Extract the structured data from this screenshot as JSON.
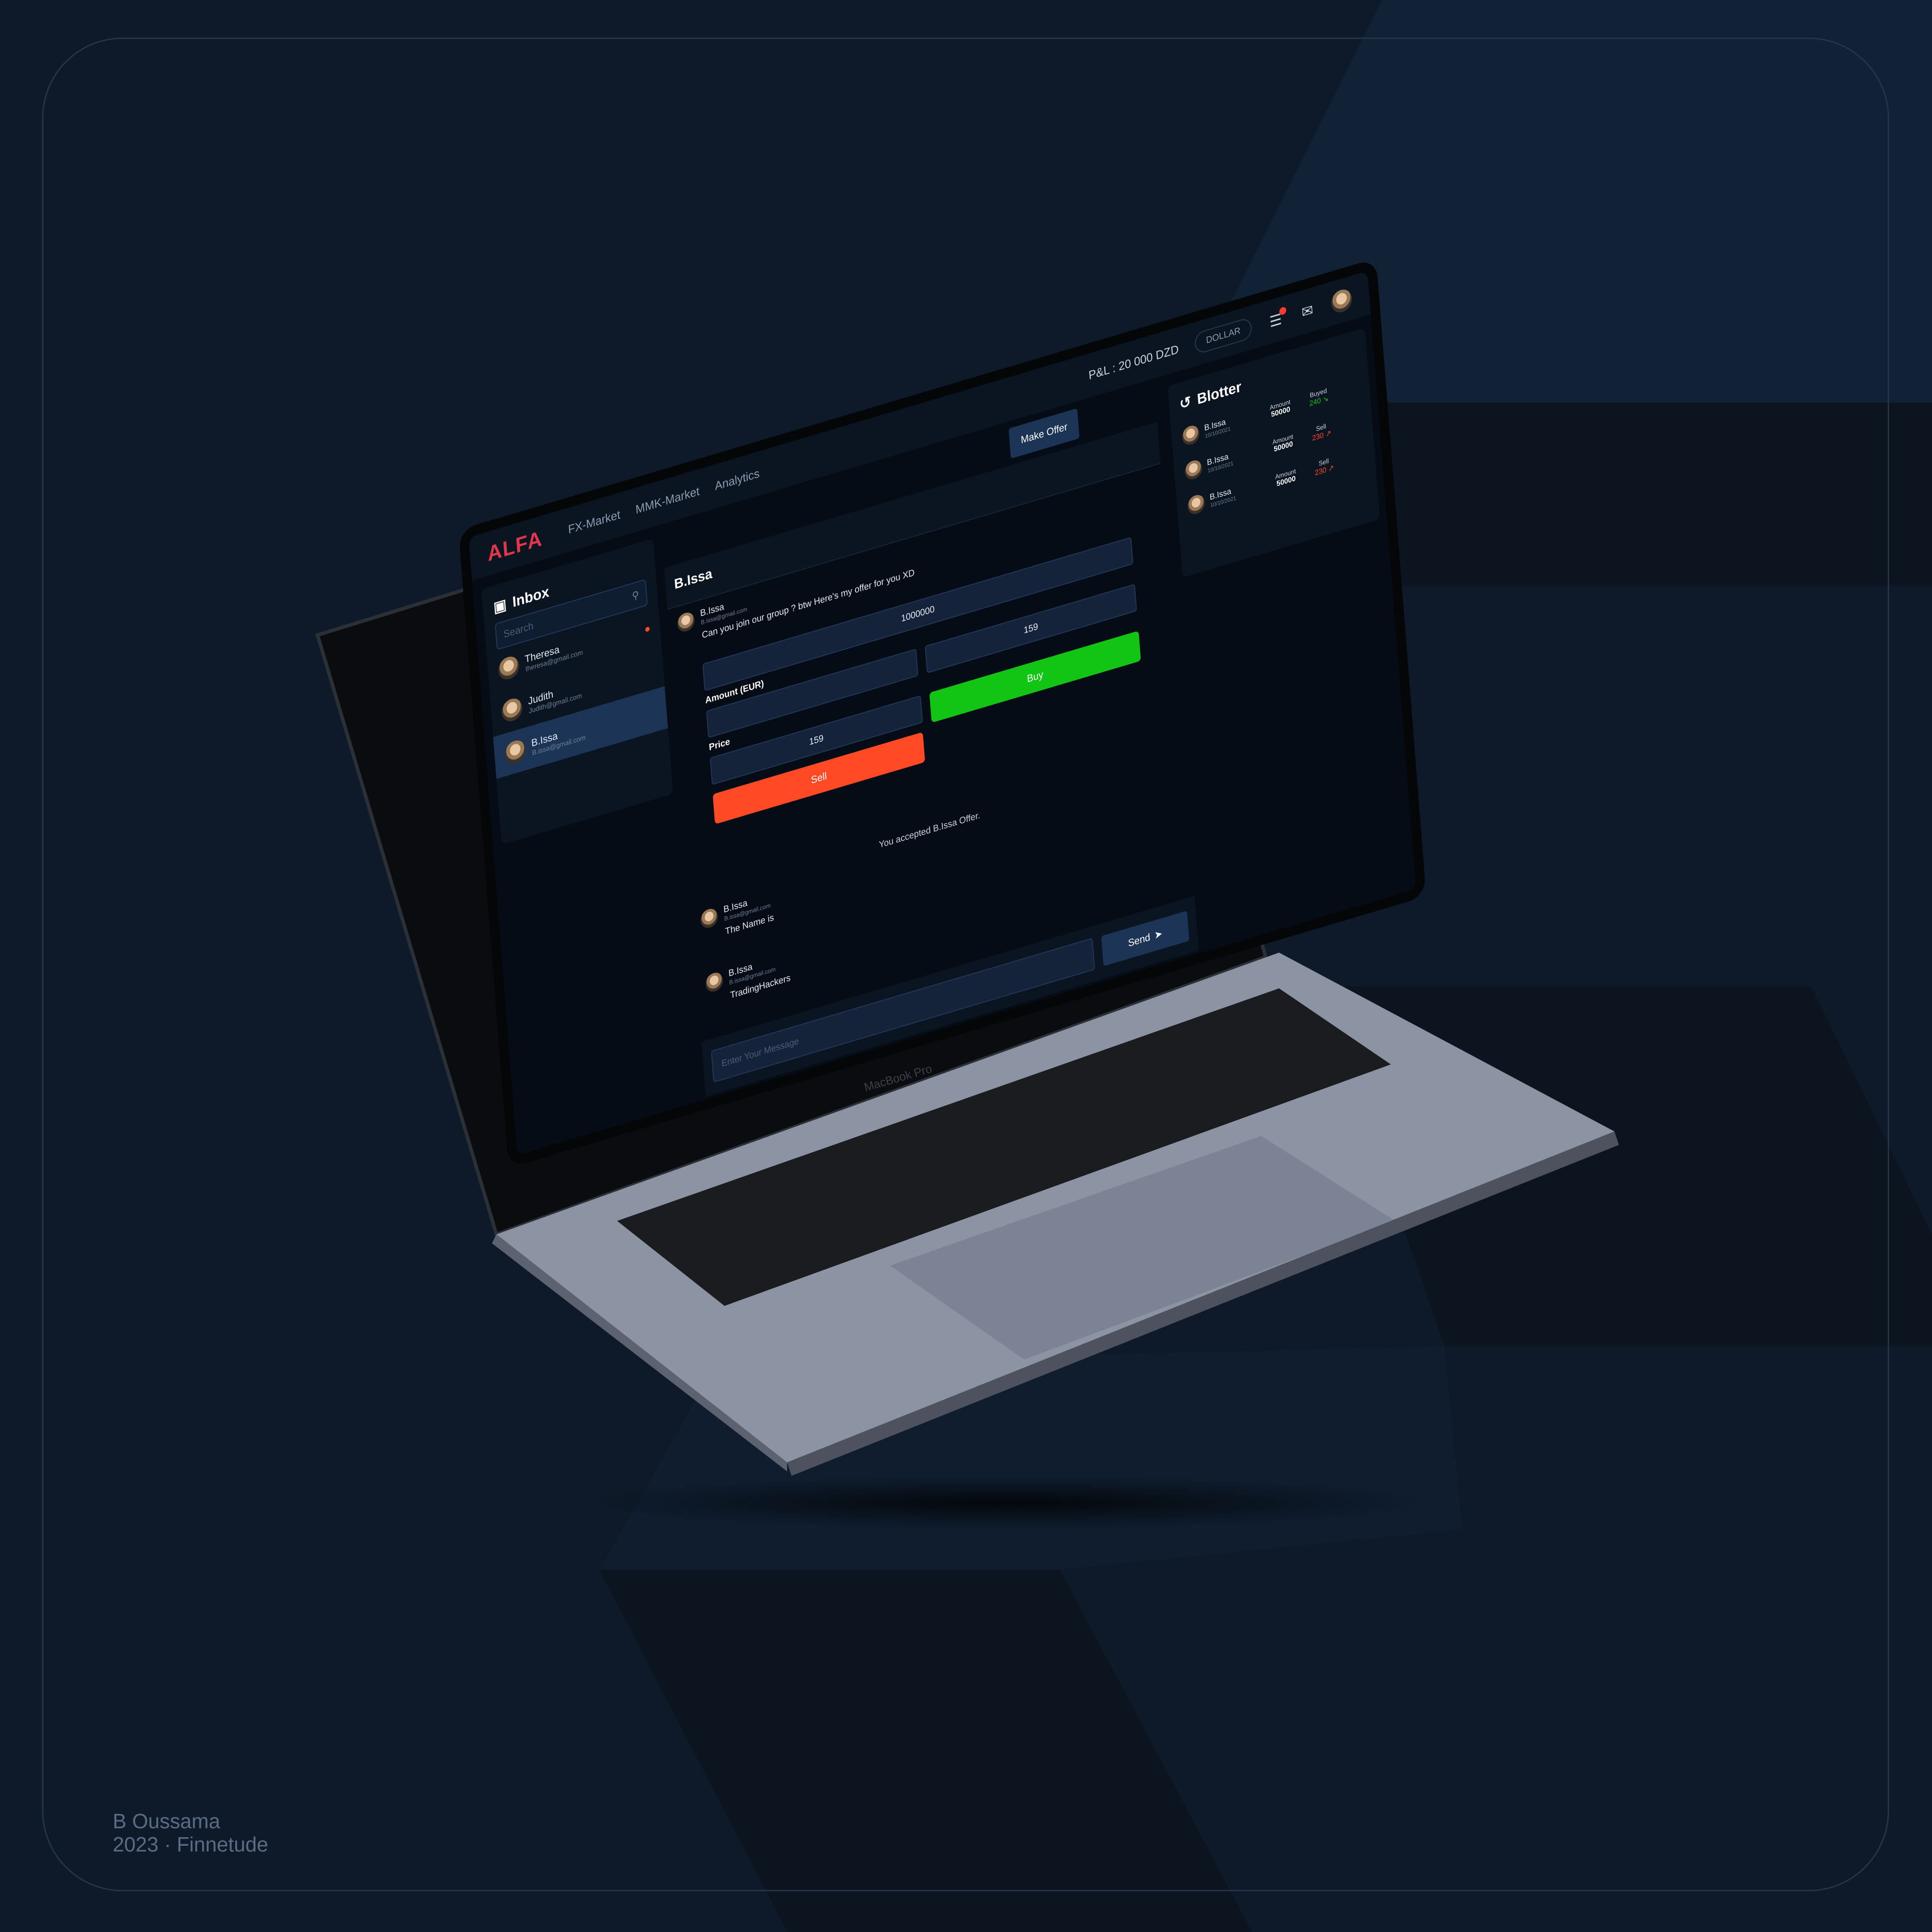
{
  "app": {
    "logo": "ALFA",
    "nav": [
      "FX-Market",
      "MMK-Market",
      "Analytics"
    ],
    "pnl": "P&L : 20 000 DZD",
    "currency": "DOLLAR",
    "make_offer": "Make Offer"
  },
  "inbox": {
    "title": "Inbox",
    "search_placeholder": "Search",
    "contacts": [
      {
        "name": "Theresa",
        "email": "theresa@gmail.com",
        "unread": true
      },
      {
        "name": "Judith",
        "email": "Judith@gmail.com",
        "unread": false
      },
      {
        "name": "B.Issa",
        "email": "B.issa@gmail.com",
        "unread": false,
        "active": true
      }
    ]
  },
  "chat": {
    "title": "B.Issa",
    "messages": [
      {
        "name": "B.Issa",
        "email": "B.issa@gmail.com",
        "text": "Can you  join our group ? btw Here's my offer for you XD"
      },
      {
        "name": "B.Issa",
        "email": "B.issa@gmail.com",
        "text": "The Name is"
      },
      {
        "name": "B.Issa",
        "email": "B.issa@gmail.com",
        "text": "TradingHackers"
      }
    ],
    "offer": {
      "amount_label": "Amount (EUR)",
      "amount_value": "1000000",
      "price_label": "Price",
      "sell_price": "159",
      "buy_price": "159",
      "sell_label": "Sell",
      "buy_label": "Buy"
    },
    "system_message": "You accepted B.Issa Offer.",
    "input_placeholder": "Enter Your Message",
    "send_label": "Send"
  },
  "blotter": {
    "title": "Blotter",
    "rows": [
      {
        "name": "B.Issa",
        "date": "10/10/2021",
        "amount_label": "Amount",
        "amount": "50000",
        "side": "Buyed",
        "value": "240",
        "dir": "up"
      },
      {
        "name": "B.Issa",
        "date": "10/10/2021",
        "amount_label": "Amount",
        "amount": "50000",
        "side": "Sell",
        "value": "230",
        "dir": "down"
      },
      {
        "name": "B.Issa",
        "date": "10/10/2021",
        "amount_label": "Amount",
        "amount": "50000",
        "side": "Sell",
        "value": "230",
        "dir": "down"
      }
    ]
  },
  "device": {
    "label": "MacBook Pro"
  },
  "credits": {
    "author": "B Oussama",
    "line2": "2023 · Finnetude"
  },
  "colors": {
    "background": "#0e1a29",
    "accent": "#1c3556",
    "sell": "#ff4a25",
    "buy": "#12c413",
    "logo": "#e0374a"
  }
}
